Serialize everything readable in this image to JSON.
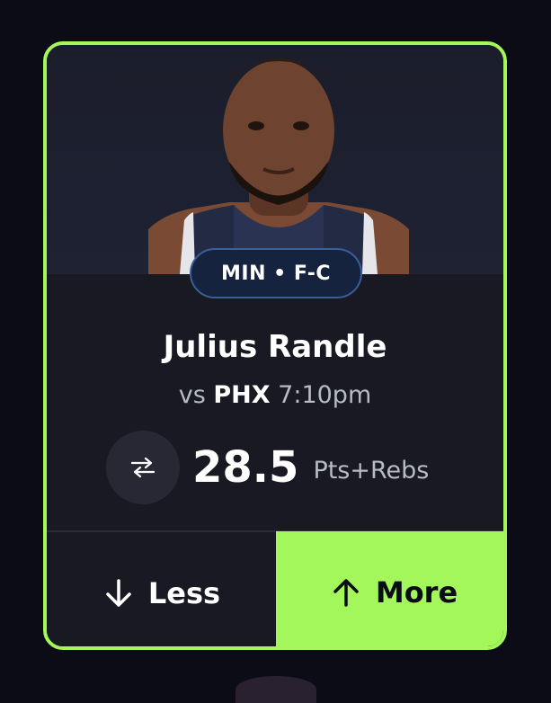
{
  "card": {
    "team_position": "MIN • F-C",
    "player_name": "Julius Randle",
    "matchup_prefix": "vs",
    "opponent": "PHX",
    "game_time": "7:10pm",
    "line_value": "28.5",
    "stat_type": "Pts+Rebs",
    "less_label": "Less",
    "more_label": "More",
    "icons": {
      "swap": "swap-arrows-icon",
      "less": "arrow-down-icon",
      "more": "arrow-up-icon"
    }
  },
  "colors": {
    "accent": "#a3f75a",
    "card_bg": "#181922",
    "page_bg": "#0b0c16",
    "badge_bg": "#15233f",
    "badge_border": "#3a5f99"
  }
}
